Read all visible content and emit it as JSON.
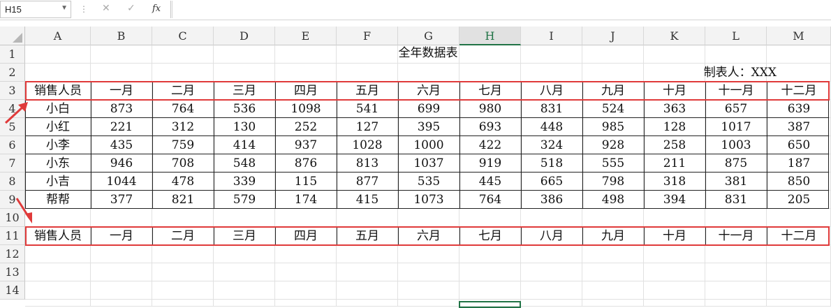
{
  "formula_bar": {
    "name_box": "H15",
    "cancel_icon": "✕",
    "enter_icon": "✓",
    "fx_label": "fx",
    "formula": ""
  },
  "columns": [
    "A",
    "B",
    "C",
    "D",
    "E",
    "F",
    "G",
    "H",
    "I",
    "J",
    "K",
    "L",
    "M"
  ],
  "selected_column": "H",
  "rows": [
    "1",
    "2",
    "3",
    "4",
    "5",
    "6",
    "7",
    "8",
    "9",
    "10",
    "11",
    "12",
    "13",
    "14"
  ],
  "sheet": {
    "title": "全年数据表",
    "maker": "制表人：XXX",
    "header_row": [
      "销售人员",
      "一月",
      "二月",
      "三月",
      "四月",
      "五月",
      "六月",
      "七月",
      "八月",
      "九月",
      "十月",
      "十一月",
      "十二月"
    ],
    "data": [
      [
        "小白",
        "873",
        "764",
        "536",
        "1098",
        "541",
        "699",
        "980",
        "831",
        "524",
        "363",
        "657",
        "639"
      ],
      [
        "小红",
        "221",
        "312",
        "130",
        "252",
        "127",
        "395",
        "693",
        "448",
        "985",
        "128",
        "1017",
        "387"
      ],
      [
        "小李",
        "435",
        "759",
        "414",
        "937",
        "1028",
        "1000",
        "422",
        "324",
        "928",
        "258",
        "1003",
        "650"
      ],
      [
        "小东",
        "946",
        "708",
        "548",
        "876",
        "813",
        "1037",
        "919",
        "518",
        "555",
        "211",
        "875",
        "187"
      ],
      [
        "小吉",
        "1044",
        "478",
        "339",
        "115",
        "877",
        "535",
        "445",
        "665",
        "798",
        "318",
        "381",
        "850"
      ],
      [
        "帮帮",
        "377",
        "821",
        "579",
        "174",
        "415",
        "1073",
        "764",
        "386",
        "498",
        "394",
        "831",
        "205"
      ]
    ],
    "copied_header_row": [
      "销售人员",
      "一月",
      "二月",
      "三月",
      "四月",
      "五月",
      "六月",
      "七月",
      "八月",
      "九月",
      "十月",
      "十一月",
      "十二月"
    ]
  },
  "colors": {
    "highlight": "#e03a3a",
    "selection": "#217346"
  }
}
